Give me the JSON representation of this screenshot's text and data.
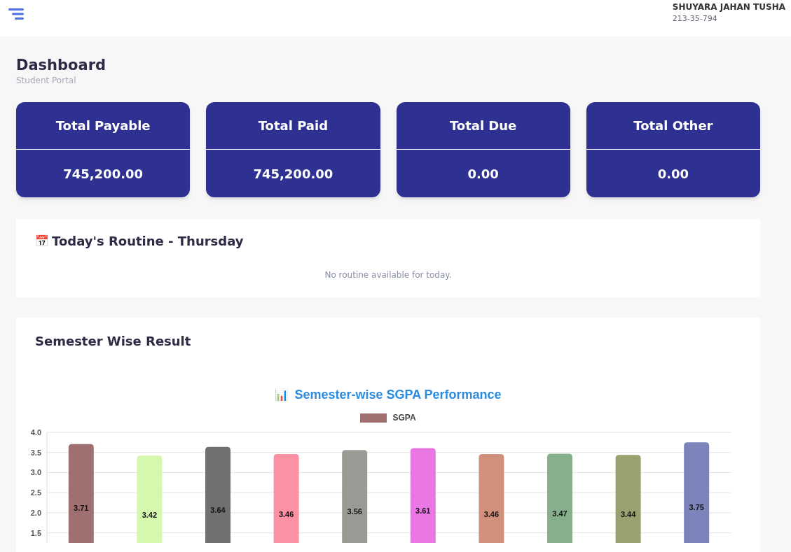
{
  "header": {
    "user_name": "SHUYARA JAHAN TUSHA",
    "user_id": "213-35-794"
  },
  "page": {
    "title": "Dashboard",
    "subtitle": "Student Portal"
  },
  "summary_cards": [
    {
      "label": "Total Payable",
      "value": "745,200.00"
    },
    {
      "label": "Total Paid",
      "value": "745,200.00"
    },
    {
      "label": "Total Due",
      "value": "0.00"
    },
    {
      "label": "Total Other",
      "value": "0.00"
    }
  ],
  "routine": {
    "icon": "📅",
    "title": "Today's Routine - Thursday",
    "empty_message": "No routine available for today."
  },
  "result": {
    "title": "Semester Wise Result",
    "chart_icon": "📊",
    "bars": [
      {
        "color": "#a07070"
      },
      {
        "color": "#d5f8ae"
      },
      {
        "color": "#6f7072"
      },
      {
        "color": "#fd91a4"
      },
      {
        "color": "#9a9b95"
      },
      {
        "color": "#e877e4"
      },
      {
        "color": "#cf917c"
      },
      {
        "color": "#85b08b"
      },
      {
        "color": "#98a16f"
      },
      {
        "color": "#7c84bc"
      }
    ],
    "chart_data": {
      "type": "bar",
      "title": "Semester-wise SGPA Performance",
      "grid": true,
      "ylim": [
        1.25,
        4.0
      ],
      "yticks": [
        {
          "value": 1.5,
          "label": "1.5"
        },
        {
          "value": 2,
          "label": "2.0"
        },
        {
          "value": 2.5,
          "label": "2.5"
        },
        {
          "value": 3,
          "label": "3.0"
        },
        {
          "value": 3.5,
          "label": "3.5"
        },
        {
          "value": 4,
          "label": "4.0"
        }
      ],
      "value_labels": [
        "3.71",
        "3.42",
        "3.64",
        "3.46",
        "3.56",
        "3.61",
        "3.46",
        "3.47",
        "3.44",
        "3.75"
      ],
      "series": [
        {
          "name": "SGPA",
          "values": [
            3.71,
            3.42,
            3.64,
            3.46,
            3.56,
            3.61,
            3.46,
            3.47,
            3.44,
            3.75
          ]
        }
      ]
    }
  }
}
